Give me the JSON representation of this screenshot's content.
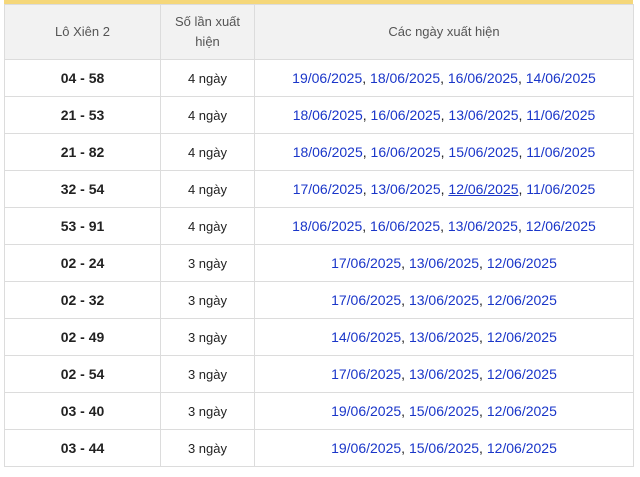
{
  "header": {
    "col1": "Lô Xiên 2",
    "col2": "Số lần xuất hiện",
    "col3": "Các ngày xuất hiện"
  },
  "rows": [
    {
      "pair": "04 - 58",
      "count": "4 ngày",
      "dates": [
        "19/06/2025",
        "18/06/2025",
        "16/06/2025",
        "14/06/2025"
      ]
    },
    {
      "pair": "21 - 53",
      "count": "4 ngày",
      "dates": [
        "18/06/2025",
        "16/06/2025",
        "13/06/2025",
        "11/06/2025"
      ]
    },
    {
      "pair": "21 - 82",
      "count": "4 ngày",
      "dates": [
        "18/06/2025",
        "16/06/2025",
        "15/06/2025",
        "11/06/2025"
      ]
    },
    {
      "pair": "32 - 54",
      "count": "4 ngày",
      "dates": [
        "17/06/2025",
        "13/06/2025",
        "12/06/2025",
        "11/06/2025"
      ],
      "underlined": 2
    },
    {
      "pair": "53 - 91",
      "count": "4 ngày",
      "dates": [
        "18/06/2025",
        "16/06/2025",
        "13/06/2025",
        "12/06/2025"
      ]
    },
    {
      "pair": "02 - 24",
      "count": "3 ngày",
      "dates": [
        "17/06/2025",
        "13/06/2025",
        "12/06/2025"
      ]
    },
    {
      "pair": "02 - 32",
      "count": "3 ngày",
      "dates": [
        "17/06/2025",
        "13/06/2025",
        "12/06/2025"
      ]
    },
    {
      "pair": "02 - 49",
      "count": "3 ngày",
      "dates": [
        "14/06/2025",
        "13/06/2025",
        "12/06/2025"
      ]
    },
    {
      "pair": "02 - 54",
      "count": "3 ngày",
      "dates": [
        "17/06/2025",
        "13/06/2025",
        "12/06/2025"
      ]
    },
    {
      "pair": "03 - 40",
      "count": "3 ngày",
      "dates": [
        "19/06/2025",
        "15/06/2025",
        "12/06/2025"
      ]
    },
    {
      "pair": "03 - 44",
      "count": "3 ngày",
      "dates": [
        "19/06/2025",
        "15/06/2025",
        "12/06/2025"
      ]
    }
  ],
  "colors": {
    "accent_bar": "#f5d77a",
    "link": "#1a36c9",
    "header_bg": "#f2f2f2"
  }
}
